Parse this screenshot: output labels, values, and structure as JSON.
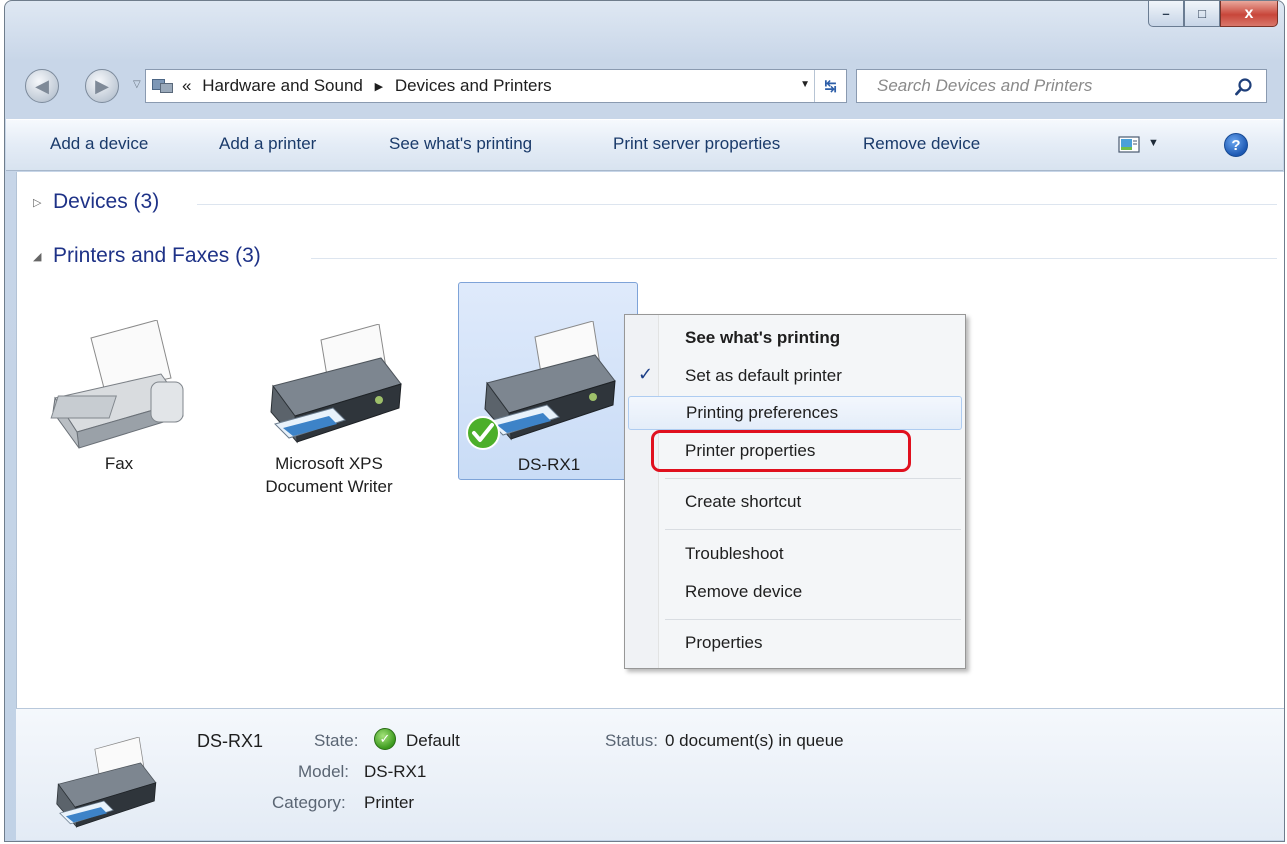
{
  "window": {
    "caption": {
      "minimize": "–",
      "maximize": "□",
      "close": "x"
    }
  },
  "address_bar": {
    "overflow": "«",
    "crumbs": [
      "Hardware and Sound",
      "Devices and Printers"
    ],
    "separator": "▶"
  },
  "search": {
    "placeholder": "Search Devices and Printers"
  },
  "toolbar": {
    "add_device": "Add a device",
    "add_printer": "Add a printer",
    "see_printing": "See what's printing",
    "print_server": "Print server properties",
    "remove_device": "Remove device",
    "help": "?"
  },
  "groups": {
    "devices": "Devices (3)",
    "printers": "Printers and Faxes (3)"
  },
  "devices": [
    {
      "line1": "Fax",
      "line2": "",
      "icon": "fax-icon"
    },
    {
      "line1": "Microsoft XPS",
      "line2": "Document Writer",
      "icon": "printer-icon"
    },
    {
      "line1": "DS-RX1",
      "line2": "",
      "icon": "printer-icon",
      "selected": true,
      "default": true
    }
  ],
  "context_menu": {
    "see_printing": "See what's printing",
    "set_default": "Set as default printer",
    "set_default_checked": true,
    "printing_prefs": "Printing preferences",
    "printer_props": "Printer properties",
    "create_shortcut": "Create shortcut",
    "troubleshoot": "Troubleshoot",
    "remove_device": "Remove device",
    "properties": "Properties"
  },
  "details": {
    "name": "DS-RX1",
    "state_label": "State:",
    "state_value": "Default",
    "model_label": "Model:",
    "model_value": "DS-RX1",
    "category_label": "Category:",
    "category_value": "Printer",
    "status_label": "Status:",
    "status_value": "0 document(s) in queue"
  },
  "colors": {
    "accent_link": "#1e3287",
    "annotation_red": "#e0101e",
    "selection": "#c9dcf6"
  }
}
